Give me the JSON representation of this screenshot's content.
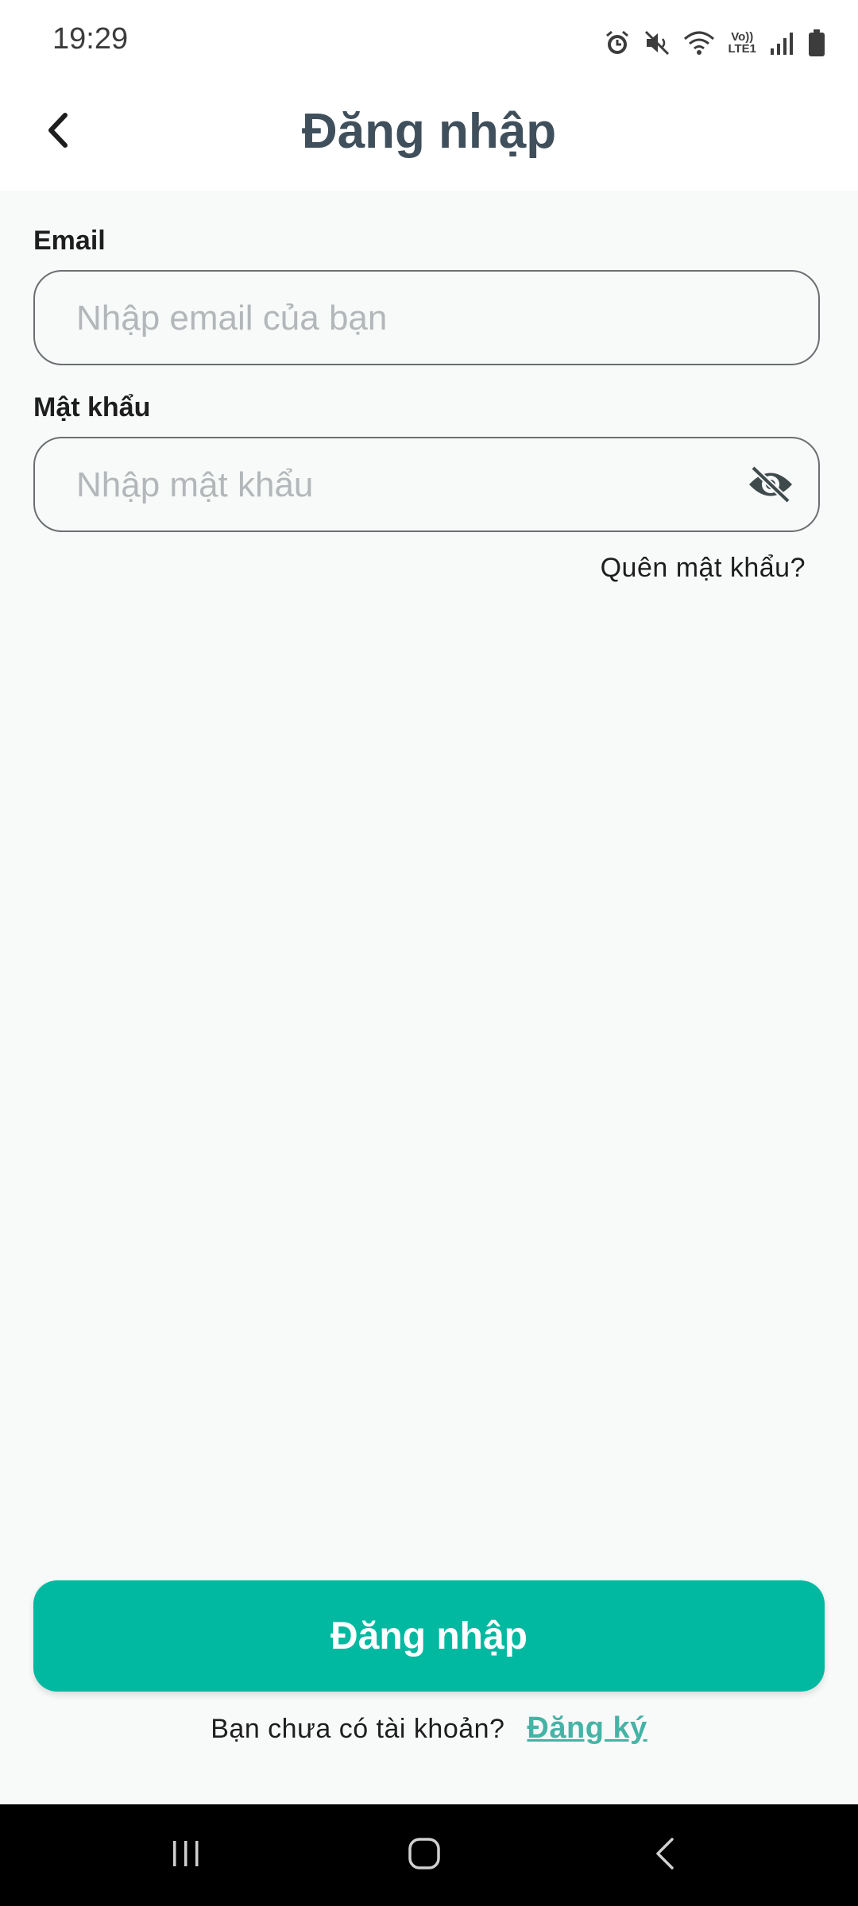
{
  "status_bar": {
    "time": "19:29",
    "icons": [
      "alarm-icon",
      "mute-icon",
      "wifi-icon",
      "volte-lte-icon",
      "signal-icon",
      "battery-icon"
    ],
    "volte_text": "Vo))",
    "lte_text": "LTE1"
  },
  "app_bar": {
    "back_icon": "chevron-left-icon",
    "title": "Đăng nhập"
  },
  "form": {
    "email_label": "Email",
    "email_placeholder": "Nhập email của bạn",
    "email_value": "",
    "password_label": "Mật khẩu",
    "password_placeholder": "Nhập mật khẩu",
    "password_value": "",
    "password_toggle_icon": "eye-off-icon",
    "forgot_password": "Quên mật khẩu?"
  },
  "actions": {
    "login_button": "Đăng nhập",
    "no_account_text": "Bạn chưa có tài khoản?",
    "signup_link": "Đăng ký"
  },
  "colors": {
    "primary": "#00b9a0",
    "title": "#3f4f5b",
    "link": "#45b3a5",
    "background": "#f8faf9"
  },
  "nav_bar": {
    "icons": [
      "recents-icon",
      "home-icon",
      "back-icon"
    ]
  }
}
